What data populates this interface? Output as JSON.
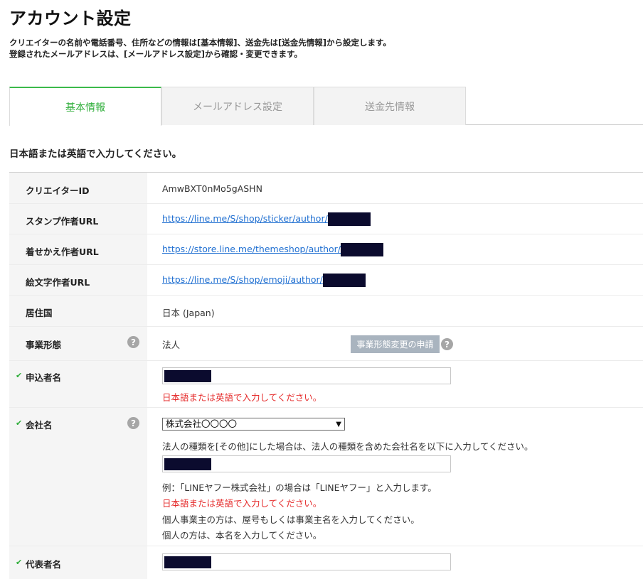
{
  "page": {
    "title": "アカウント設定",
    "intro_line1": "クリエイターの名前や電話番号、住所などの情報は[基本情報]、送金先は[送金先情報]から設定します。",
    "intro_line2": "登録されたメールアドレスは、[メールアドレス設定]から確認・変更できます。"
  },
  "tabs": [
    {
      "label": "基本情報",
      "active": true
    },
    {
      "label": "メールアドレス設定",
      "active": false
    },
    {
      "label": "送金先情報",
      "active": false
    }
  ],
  "form": {
    "lang_note": "日本語または英語で入力してください。",
    "creator_id": {
      "label": "クリエイターID",
      "value": "AmwBXT0nMo5gASHN"
    },
    "sticker_url": {
      "label": "スタンプ作者URL",
      "value": "https://line.me/S/shop/sticker/author/"
    },
    "theme_url": {
      "label": "着せかえ作者URL",
      "value": "https://store.line.me/themeshop/author/"
    },
    "emoji_url": {
      "label": "絵文字作者URL",
      "value": "https://line.me/S/shop/emoji/author/"
    },
    "country": {
      "label": "居住国",
      "value": "日本 (Japan)"
    },
    "business": {
      "label": "事業形態",
      "value": "法人",
      "button": "事業形態変更の申請"
    },
    "applicant": {
      "label": "申込者名",
      "error": "日本語または英語で入力してください。"
    },
    "company": {
      "label": "会社名",
      "selected": "株式会社〇〇〇〇",
      "note1": "法人の種類を[その他]にした場合は、法人の種類を含めた会社名を以下に入力してください。",
      "example": "例：「LINEヤフー株式会社」の場合は「LINEヤフー」と入力します。",
      "error": "日本語または英語で入力してください。",
      "note2": "個人事業主の方は、屋号もしくは事業主名を入力してください。",
      "note3": "個人の方は、本名を入力してください。"
    },
    "representative": {
      "label": "代表者名"
    }
  },
  "icons": {
    "check": "check-icon",
    "help": "question-circle-icon",
    "dropdown": "chevron-down-icon"
  },
  "colors": {
    "accent": "#3cba4a",
    "error": "#e52b2b",
    "link": "#1f6fd1",
    "redaction": "#0b0b2e"
  }
}
